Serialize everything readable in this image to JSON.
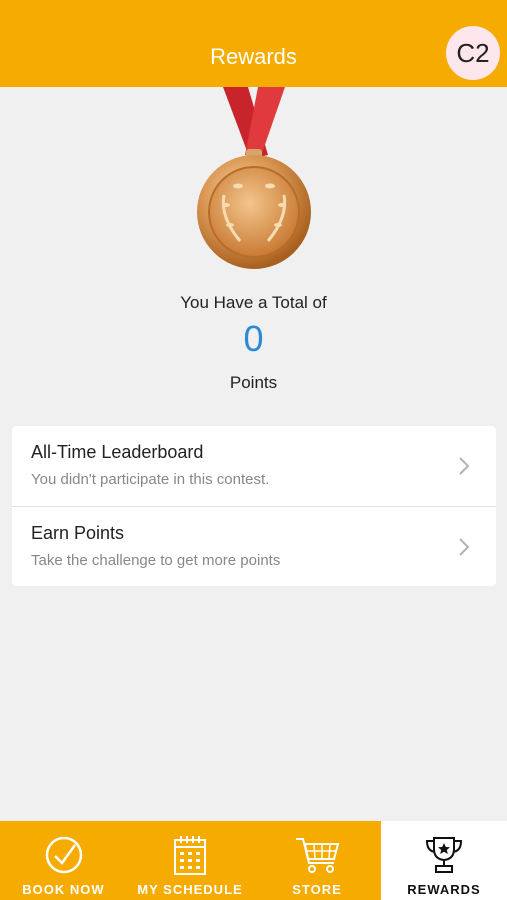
{
  "header": {
    "title": "Rewards",
    "avatar_initials": "C2"
  },
  "rewards": {
    "caption": "You Have a Total of",
    "points": "0",
    "unit": "Points"
  },
  "menu": [
    {
      "title": "All-Time Leaderboard",
      "subtitle": "You didn't participate in this contest."
    },
    {
      "title": "Earn Points",
      "subtitle": "Take the challenge to get more points"
    }
  ],
  "tabs": [
    {
      "label": "BOOK NOW",
      "icon": "check-circle-icon",
      "active": false
    },
    {
      "label": "MY SCHEDULE",
      "icon": "calendar-icon",
      "active": false
    },
    {
      "label": "STORE",
      "icon": "cart-icon",
      "active": false
    },
    {
      "label": "REWARDS",
      "icon": "trophy-icon",
      "active": true
    }
  ],
  "colors": {
    "accent": "#f5ab00",
    "points": "#2a8ad8",
    "ribbon": "#d32f2f",
    "medal": "#d98d3f"
  }
}
